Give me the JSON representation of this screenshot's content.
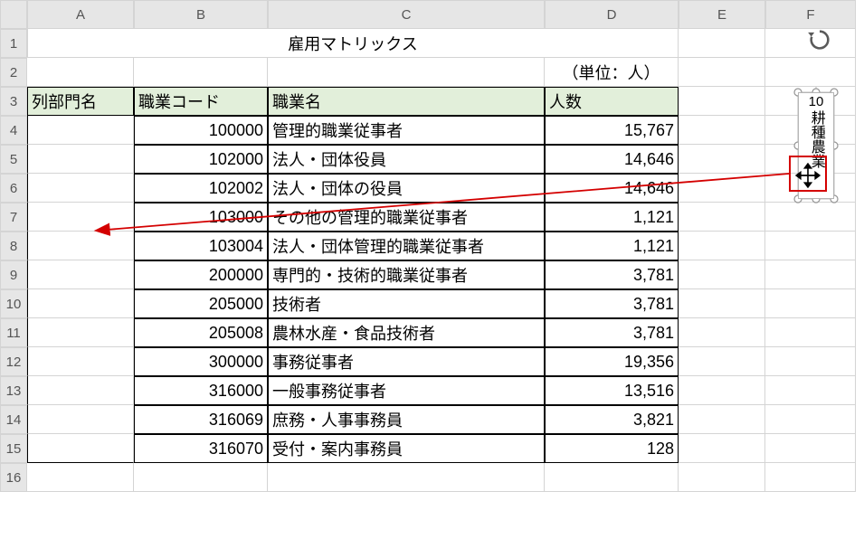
{
  "columns": [
    "A",
    "B",
    "C",
    "D",
    "E",
    "F"
  ],
  "row_numbers": [
    "1",
    "2",
    "3",
    "4",
    "5",
    "6",
    "7",
    "8",
    "9",
    "10",
    "11",
    "12",
    "13",
    "14",
    "15",
    "16"
  ],
  "title": "雇用マトリックス",
  "unit_label": "（単位：人）",
  "headers": {
    "col_dept": "列部門名",
    "job_code": "職業コード",
    "job_name": "職業名",
    "count": "人数"
  },
  "rows": [
    {
      "code": "100000",
      "name": "管理的職業従事者",
      "count": "15,767"
    },
    {
      "code": "102000",
      "name": "法人・団体役員",
      "count": "14,646"
    },
    {
      "code": "102002",
      "name": "法人・団体の役員",
      "count": "14,646"
    },
    {
      "code": "103000",
      "name": "その他の管理的職業従事者",
      "count": "1,121"
    },
    {
      "code": "103004",
      "name": "法人・団体管理的職業従事者",
      "count": "1,121"
    },
    {
      "code": "200000",
      "name": "専門的・技術的職業従事者",
      "count": "3,781"
    },
    {
      "code": "205000",
      "name": "技術者",
      "count": "3,781"
    },
    {
      "code": "205008",
      "name": "農林水産・食品技術者",
      "count": "3,781"
    },
    {
      "code": "300000",
      "name": "事務従事者",
      "count": "19,356"
    },
    {
      "code": "316000",
      "name": "一般事務従事者",
      "count": "13,516"
    },
    {
      "code": "316069",
      "name": "庶務・人事事務員",
      "count": "3,821"
    },
    {
      "code": "316070",
      "name": "受付・案内事務員",
      "count": "128"
    }
  ],
  "textbox": {
    "number": "10",
    "text": "耕種農業"
  },
  "chart_data": {
    "type": "table",
    "title": "雇用マトリックス",
    "unit": "人",
    "columns": [
      "列部門名",
      "職業コード",
      "職業名",
      "人数"
    ],
    "rows": [
      [
        "",
        100000,
        "管理的職業従事者",
        15767
      ],
      [
        "",
        102000,
        "法人・団体役員",
        14646
      ],
      [
        "",
        102002,
        "法人・団体の役員",
        14646
      ],
      [
        "",
        103000,
        "その他の管理的職業従事者",
        1121
      ],
      [
        "",
        103004,
        "法人・団体管理的職業従事者",
        1121
      ],
      [
        "",
        200000,
        "専門的・技術的職業従事者",
        3781
      ],
      [
        "",
        205000,
        "技術者",
        3781
      ],
      [
        "",
        205008,
        "農林水産・食品技術者",
        3781
      ],
      [
        "",
        300000,
        "事務従事者",
        19356
      ],
      [
        "",
        316000,
        "一般事務従事者",
        13516
      ],
      [
        "",
        316069,
        "庶務・人事事務員",
        3821
      ],
      [
        "",
        316070,
        "受付・案内事務員",
        128
      ]
    ]
  }
}
